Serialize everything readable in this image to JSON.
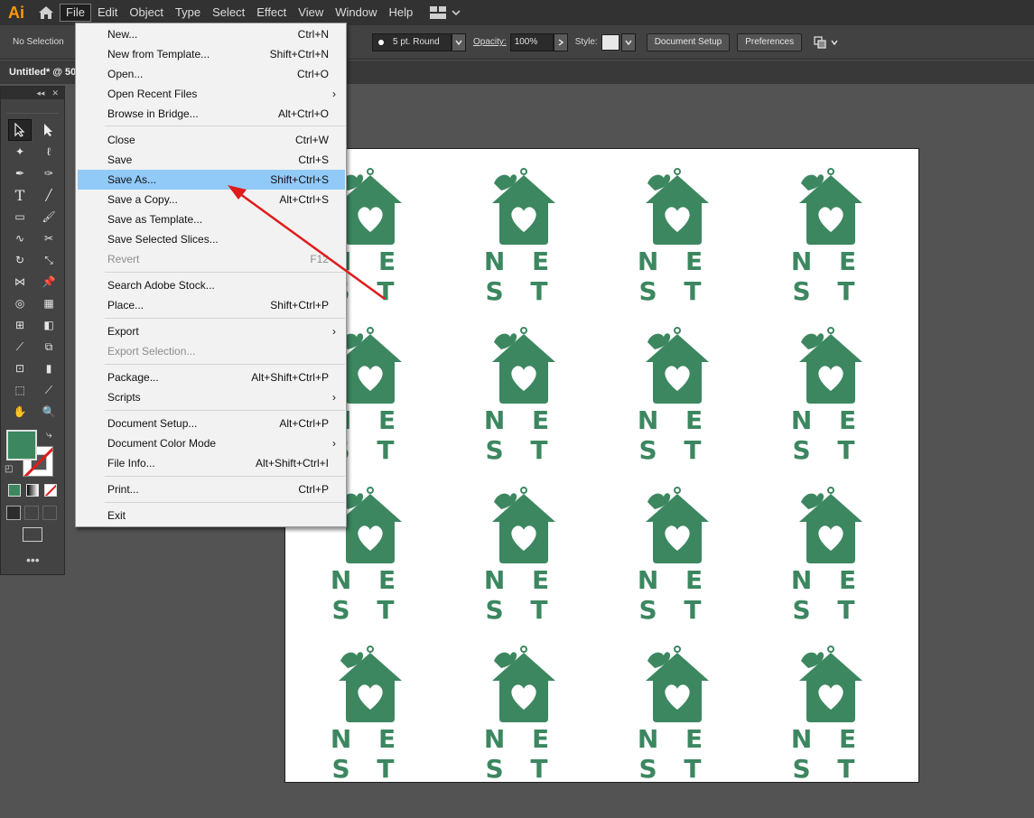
{
  "app": {
    "logo": "Ai"
  },
  "menubar": {
    "items": [
      {
        "label": "File",
        "active": true
      },
      {
        "label": "Edit"
      },
      {
        "label": "Object"
      },
      {
        "label": "Type"
      },
      {
        "label": "Select"
      },
      {
        "label": "Effect"
      },
      {
        "label": "View"
      },
      {
        "label": "Window"
      },
      {
        "label": "Help"
      }
    ]
  },
  "control_bar": {
    "selection_state": "No Selection",
    "brush": "5 pt. Round",
    "opacity_label": "Opacity:",
    "opacity_value": "100%",
    "style_label": "Style:",
    "document_setup": "Document Setup",
    "preferences": "Preferences"
  },
  "document_tab": {
    "title": "Untitled* @ 50"
  },
  "file_menu": {
    "items": [
      {
        "label": "New...",
        "shortcut": "Ctrl+N"
      },
      {
        "label": "New from Template...",
        "shortcut": "Shift+Ctrl+N"
      },
      {
        "label": "Open...",
        "shortcut": "Ctrl+O"
      },
      {
        "label": "Open Recent Files",
        "submenu": "›"
      },
      {
        "label": "Browse in Bridge...",
        "shortcut": "Alt+Ctrl+O"
      },
      {
        "label": "Close",
        "shortcut": "Ctrl+W"
      },
      {
        "label": "Save",
        "shortcut": "Ctrl+S"
      },
      {
        "label": "Save As...",
        "shortcut": "Shift+Ctrl+S"
      },
      {
        "label": "Save a Copy...",
        "shortcut": "Alt+Ctrl+S"
      },
      {
        "label": "Save as Template..."
      },
      {
        "label": "Save Selected Slices..."
      },
      {
        "label": "Revert",
        "shortcut": "F12"
      },
      {
        "label": "Search Adobe Stock..."
      },
      {
        "label": "Place...",
        "shortcut": "Shift+Ctrl+P"
      },
      {
        "label": "Export",
        "submenu": "›"
      },
      {
        "label": "Export Selection..."
      },
      {
        "label": "Package...",
        "shortcut": "Alt+Shift+Ctrl+P"
      },
      {
        "label": "Scripts",
        "submenu": "›"
      },
      {
        "label": "Document Setup...",
        "shortcut": "Alt+Ctrl+P"
      },
      {
        "label": "Document Color Mode",
        "submenu": "›"
      },
      {
        "label": "File Info...",
        "shortcut": "Alt+Shift+Ctrl+I"
      },
      {
        "label": "Print...",
        "shortcut": "Ctrl+P"
      },
      {
        "label": "Exit"
      }
    ]
  },
  "artwork": {
    "logo_word": "NEST",
    "color": "#3c8760"
  },
  "colors": {
    "accent": "#3c8760",
    "menu_highlight": "#91c9f7",
    "arrow": "#e01b1b"
  }
}
